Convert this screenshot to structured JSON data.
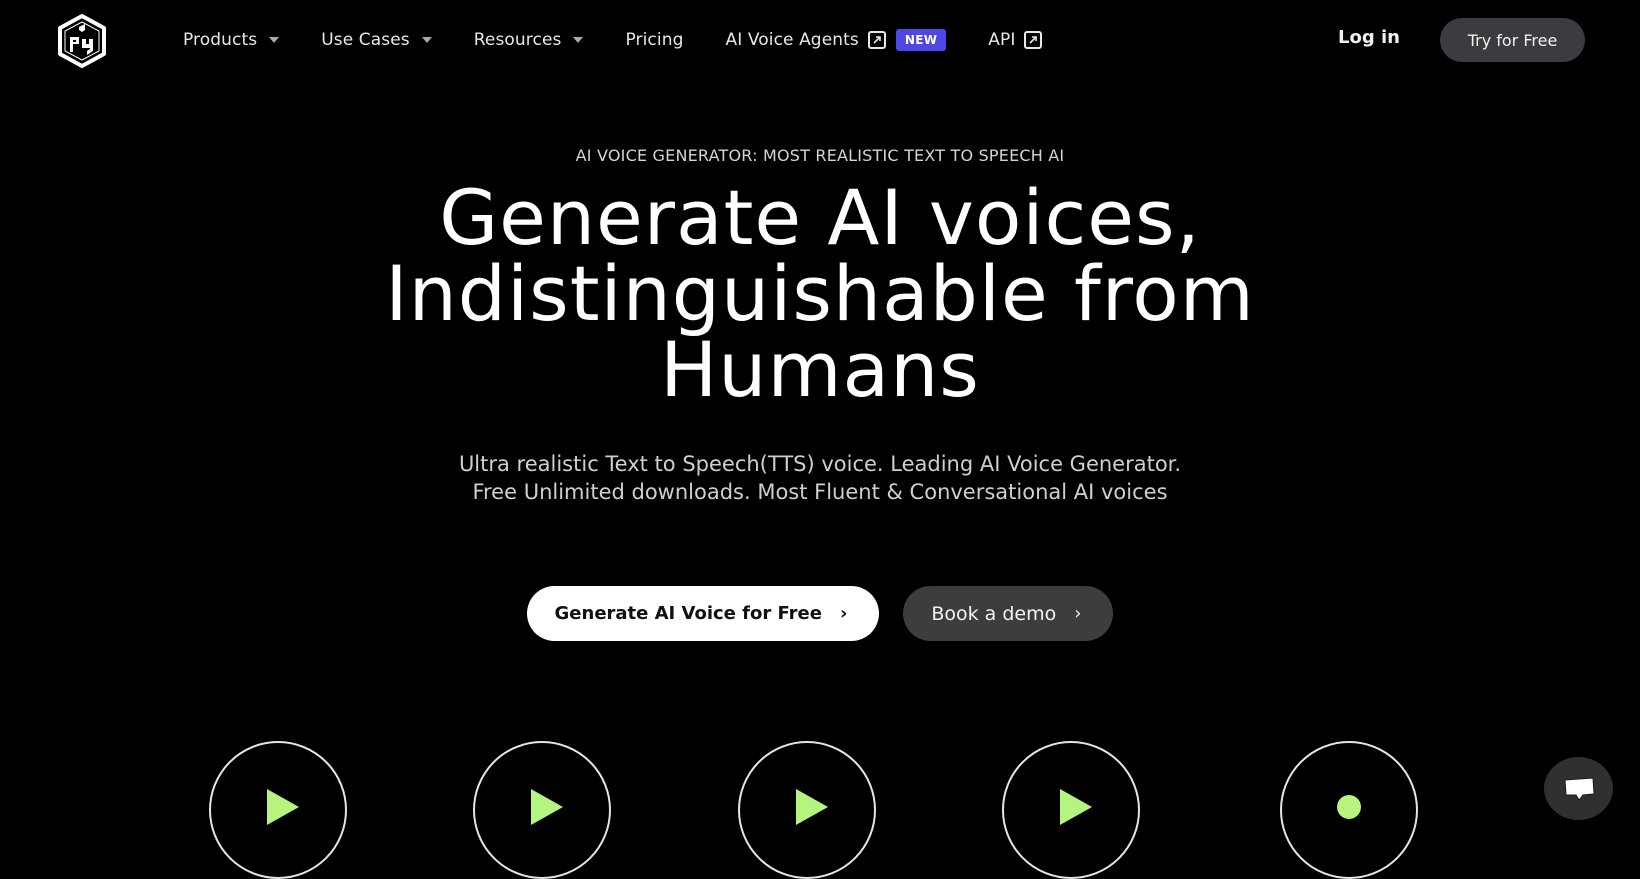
{
  "nav": {
    "logo_alt": "PlayHT logo",
    "items": [
      {
        "label": "Products",
        "has_dropdown": true
      },
      {
        "label": "Use Cases",
        "has_dropdown": true
      },
      {
        "label": "Resources",
        "has_dropdown": true
      },
      {
        "label": "Pricing",
        "has_dropdown": false
      },
      {
        "label": "AI Voice Agents",
        "external": true,
        "badge": "NEW"
      },
      {
        "label": "API",
        "external": true
      }
    ],
    "login_label": "Log in",
    "try_free_label": "Try for Free"
  },
  "hero": {
    "eyebrow": "AI VOICE GENERATOR: MOST REALISTIC TEXT TO SPEECH AI",
    "headline_line1": "Generate AI voices,",
    "headline_line2": "Indistinguishable from",
    "headline_line3": "Humans",
    "subtitle_line1": "Ultra realistic Text to Speech(TTS) voice. Leading AI Voice Generator.",
    "subtitle_line2": "Free Unlimited downloads. Most Fluent & Conversational AI voices",
    "primary_cta": "Generate AI Voice for Free",
    "secondary_cta": "Book a demo",
    "chevron": "›"
  },
  "voice_samples": [
    {
      "icon": "play-icon"
    },
    {
      "icon": "play-icon"
    },
    {
      "icon": "play-icon"
    },
    {
      "icon": "play-icon"
    },
    {
      "icon": "record-dot-icon"
    }
  ],
  "colors": {
    "background": "#000000",
    "accent_green": "#b5f57f",
    "badge_purple": "#4f46e5",
    "button_dark": "#3c3c40"
  }
}
